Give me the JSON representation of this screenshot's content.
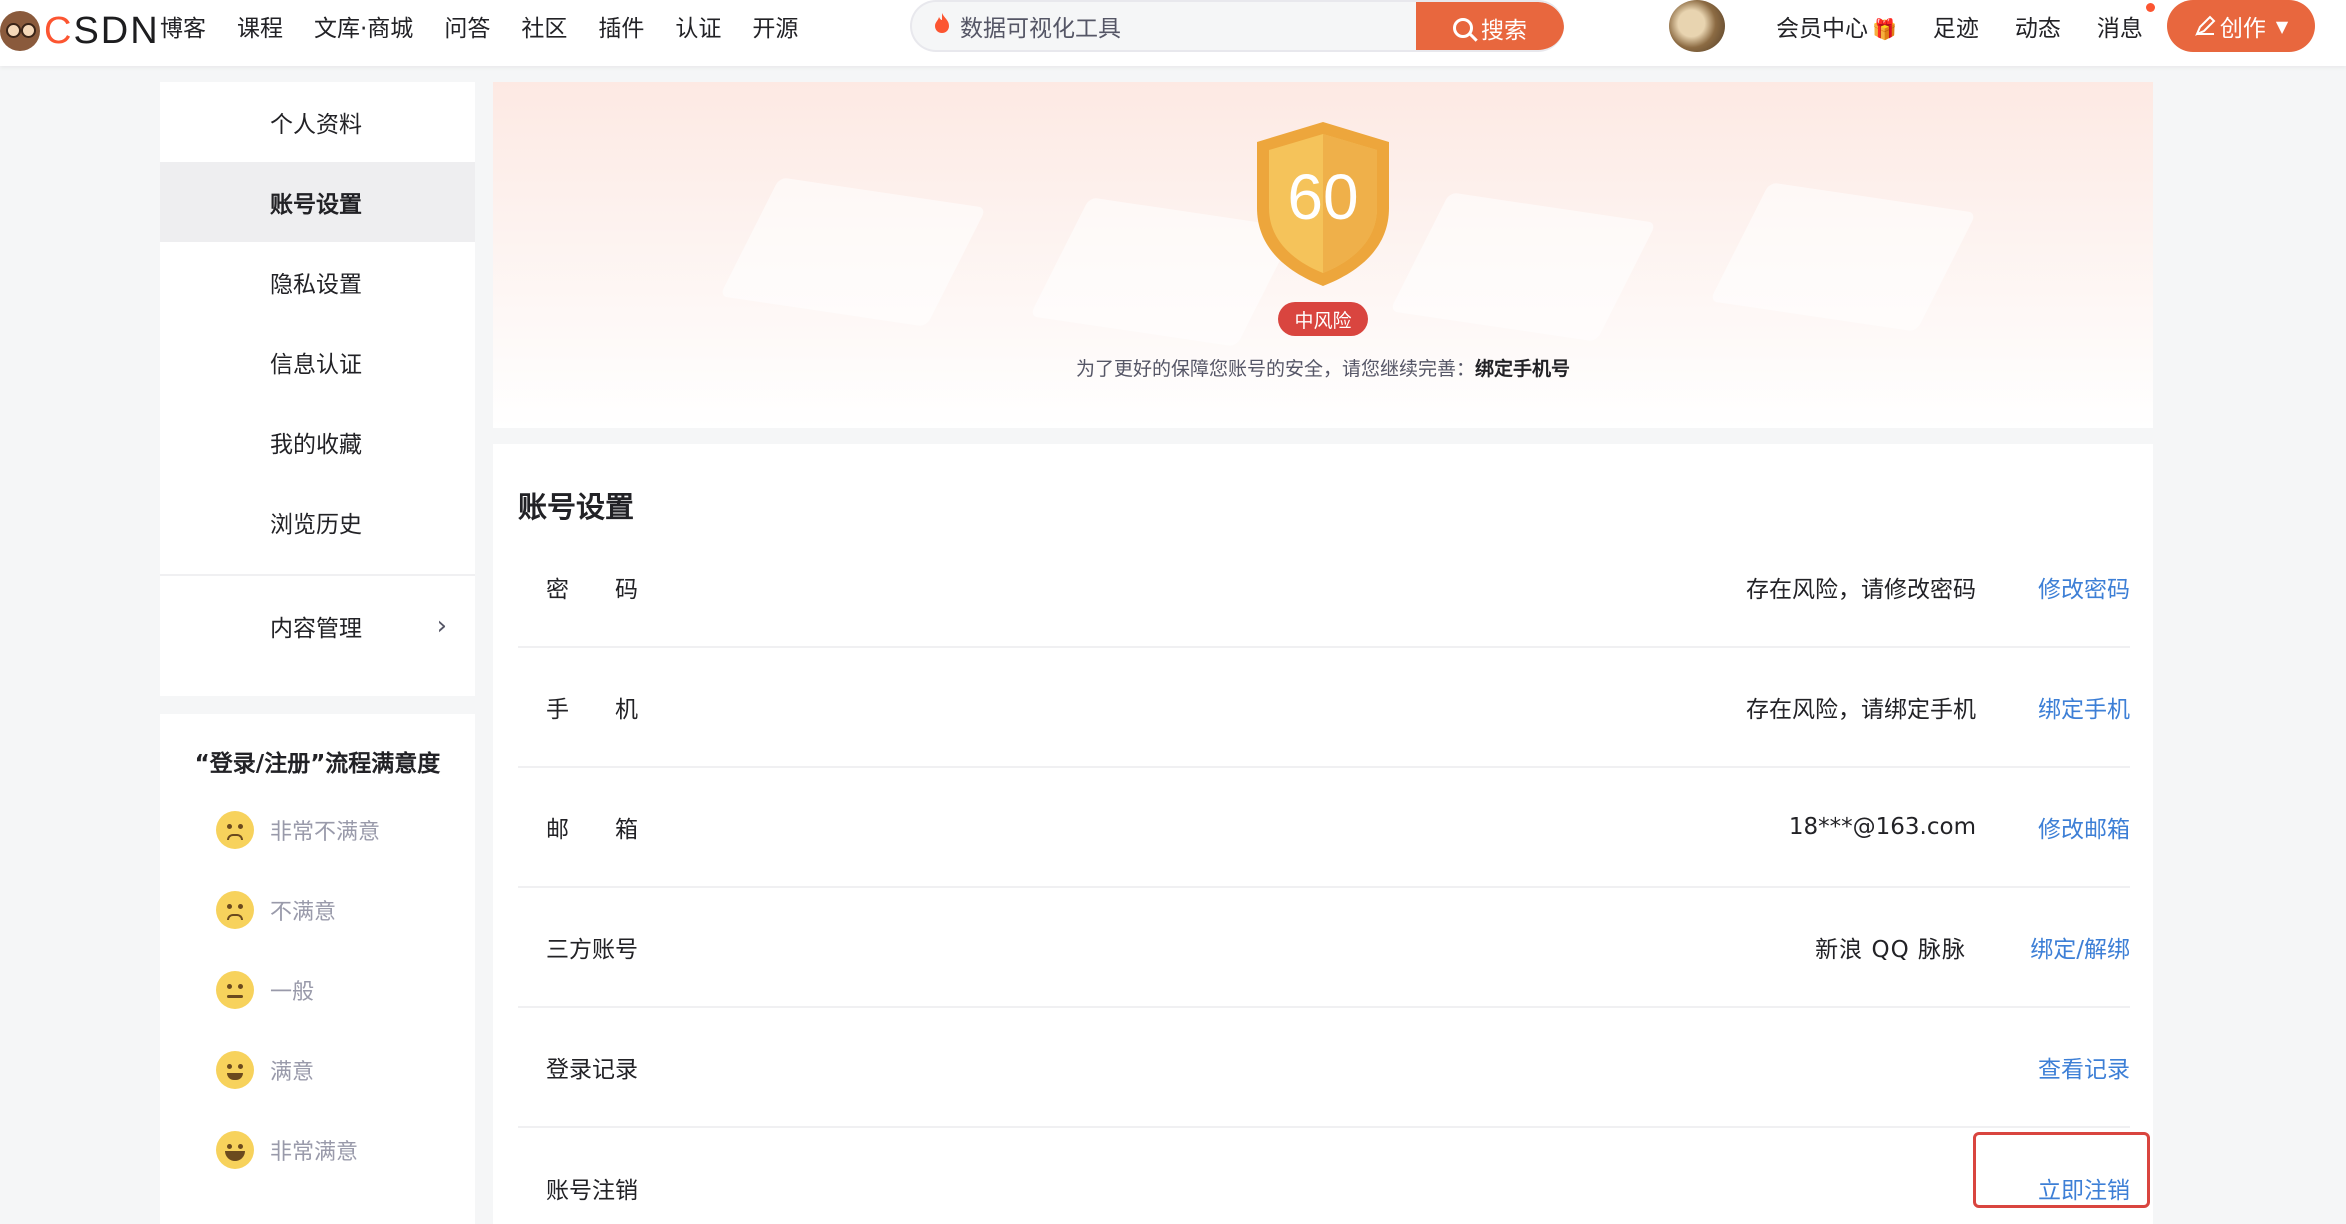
{
  "header": {
    "logo_text": "CSDN",
    "nav": [
      "博客",
      "课程",
      "文库·商城",
      "问答",
      "社区",
      "插件",
      "认证",
      "开源"
    ],
    "search": {
      "value": "数据可视化工具",
      "button_label": "搜索"
    },
    "right_nav": [
      "会员中心",
      "足迹",
      "动态",
      "消息"
    ],
    "create_label": "创作"
  },
  "sidebar": {
    "items": [
      "个人资料",
      "账号设置",
      "隐私设置",
      "信息认证",
      "我的收藏",
      "浏览历史"
    ],
    "active": "账号设置",
    "content_mgmt": "内容管理"
  },
  "survey": {
    "title": "“登录/注册”流程满意度",
    "options": [
      "非常不满意",
      "不满意",
      "一般",
      "满意",
      "非常满意"
    ]
  },
  "security": {
    "score": "60",
    "risk_label": "中风险",
    "tip_prefix": "为了更好的保障您账号的安全，请您继续完善：",
    "tip_action": "绑定手机号"
  },
  "account": {
    "title": "账号设置",
    "rows": [
      {
        "label": "密　　码",
        "value": "存在风险，请修改密码",
        "action": "修改密码"
      },
      {
        "label": "手　　机",
        "value": "存在风险，请绑定手机",
        "action": "绑定手机"
      },
      {
        "label": "邮　　箱",
        "value": "18***@163.com",
        "action": "修改邮箱"
      },
      {
        "label": "三方账号",
        "value": "新浪 QQ 脉脉",
        "action": "绑定/解绑"
      },
      {
        "label": "登录记录",
        "value": "",
        "action": "查看记录"
      },
      {
        "label": "账号注销",
        "value": "",
        "action": "立即注销"
      }
    ]
  },
  "colors": {
    "brand": "#fc5531",
    "link": "#3d7fd6",
    "risk": "#d9453f",
    "shield": "#e9a23b"
  }
}
